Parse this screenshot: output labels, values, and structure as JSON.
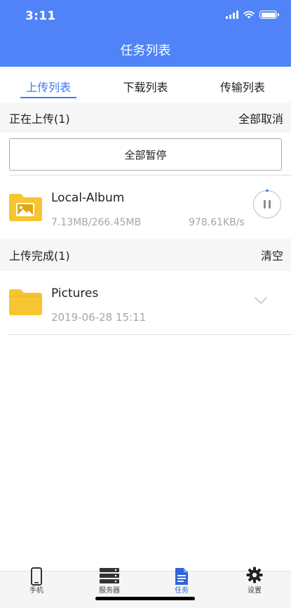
{
  "status": {
    "time": "3:11"
  },
  "header": {
    "title": "任务列表"
  },
  "tabs": [
    {
      "label": "上传列表",
      "active": true
    },
    {
      "label": "下载列表",
      "active": false
    },
    {
      "label": "传输列表",
      "active": false
    }
  ],
  "uploading": {
    "header": "正在上传(1)",
    "cancel_all": "全部取消",
    "pause_all": "全部暂停",
    "items": [
      {
        "name": "Local-Album",
        "size": "7.13MB/266.45MB",
        "speed": "978.61KB/s",
        "icon": "photo-folder-icon",
        "action_icon": "pause-icon"
      }
    ]
  },
  "completed": {
    "header": "上传完成(1)",
    "clear": "清空",
    "items": [
      {
        "name": "Pictures",
        "date": "2019-06-28 15:11",
        "icon": "folder-icon",
        "action_icon": "chevron-down-icon"
      }
    ]
  },
  "tabbar": [
    {
      "label": "手机",
      "icon": "phone-icon",
      "active": false
    },
    {
      "label": "服务器",
      "icon": "server-icon",
      "active": false
    },
    {
      "label": "任务",
      "icon": "document-icon",
      "active": true
    },
    {
      "label": "设置",
      "icon": "gear-icon",
      "active": false
    }
  ],
  "colors": {
    "accent": "#4F83F7",
    "tab_active": "#3D7AF5",
    "folder": "#F7C531",
    "section_bg": "#F6F6F6"
  }
}
